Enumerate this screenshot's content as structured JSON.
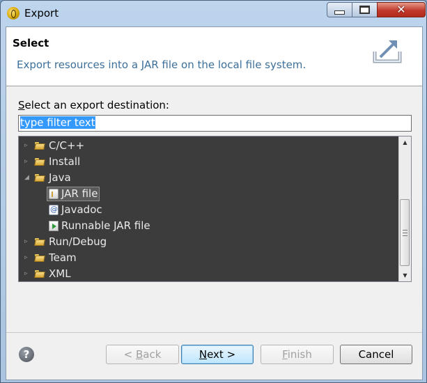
{
  "window": {
    "title": "Export",
    "controls": {
      "minimize": "minimize-icon",
      "maximize": "maximize-icon",
      "close": "close-icon"
    }
  },
  "header": {
    "title": "Select",
    "description": "Export resources into a JAR file on the local file system.",
    "icon": "export-icon"
  },
  "destination": {
    "label_prefix": "S",
    "label_rest": "elect an export destination:",
    "filter_value": "type filter text"
  },
  "tree": {
    "items": [
      {
        "label": "C/C++",
        "type": "folder",
        "expanded": false
      },
      {
        "label": "Install",
        "type": "folder",
        "expanded": false
      },
      {
        "label": "Java",
        "type": "folder",
        "expanded": true
      },
      {
        "label": "JAR file",
        "type": "jar",
        "selected": true
      },
      {
        "label": "Javadoc",
        "type": "javadoc"
      },
      {
        "label": "Runnable JAR file",
        "type": "runnable-jar"
      },
      {
        "label": "Run/Debug",
        "type": "folder",
        "expanded": false
      },
      {
        "label": "Team",
        "type": "folder",
        "expanded": false
      },
      {
        "label": "XML",
        "type": "folder",
        "expanded": false
      }
    ]
  },
  "footer": {
    "help_icon": "help-icon",
    "back": {
      "prefix": "< ",
      "mnemonic": "B",
      "rest": "ack",
      "enabled": false
    },
    "next": {
      "mnemonic": "N",
      "rest": "ext >",
      "enabled": true
    },
    "finish": {
      "mnemonic": "F",
      "rest": "inish",
      "enabled": false
    },
    "cancel": {
      "label": "Cancel",
      "enabled": true
    }
  },
  "colors": {
    "accent": "#3399ff",
    "description_text": "#3c6f9a",
    "tree_bg": "#3c3c3c"
  }
}
